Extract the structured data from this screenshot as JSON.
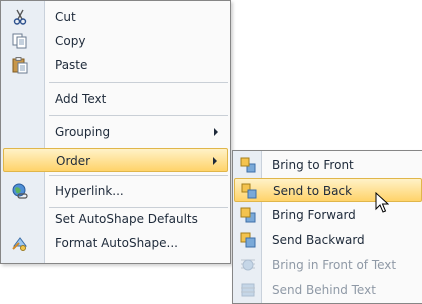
{
  "context_menu": {
    "items": [
      {
        "label": "Cut",
        "icon": "scissors-icon"
      },
      {
        "label": "Copy",
        "icon": "copy-icon"
      },
      {
        "label": "Paste",
        "icon": "paste-icon"
      },
      {
        "label": "Add Text"
      },
      {
        "label": "Grouping",
        "has_submenu": true
      },
      {
        "label": "Order",
        "has_submenu": true,
        "highlighted": true
      },
      {
        "label": "Hyperlink...",
        "icon": "hyperlink-globe-icon"
      },
      {
        "label": "Set AutoShape Defaults"
      },
      {
        "label": "Format AutoShape...",
        "icon": "format-shape-icon"
      }
    ]
  },
  "order_submenu": {
    "items": [
      {
        "label": "Bring to Front",
        "icon": "bring-to-front-icon"
      },
      {
        "label": "Send to Back",
        "icon": "send-to-back-icon",
        "highlighted": true
      },
      {
        "label": "Bring Forward",
        "icon": "bring-forward-icon"
      },
      {
        "label": "Send Backward",
        "icon": "send-backward-icon"
      },
      {
        "label": "Bring in Front of Text",
        "icon": "bring-in-front-of-text-icon",
        "disabled": true
      },
      {
        "label": "Send Behind Text",
        "icon": "send-behind-text-icon",
        "disabled": true
      }
    ]
  },
  "colors": {
    "highlight_top": "#fff2c8",
    "highlight_bottom": "#ffd36a",
    "highlight_border": "#e0b64a",
    "icon_strip": "#e9eef4"
  }
}
